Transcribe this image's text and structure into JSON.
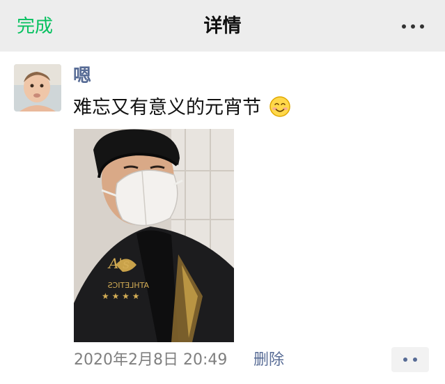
{
  "header": {
    "done_label": "完成",
    "title": "详情"
  },
  "post": {
    "username": "嗯",
    "text": "难忘又有意义的元宵节",
    "emoji": "smiling-face-blush",
    "timestamp": "2020年2月8日 20:49",
    "delete_label": "删除"
  },
  "icons": {
    "more": "more-dots-icon",
    "comment": "comment-dots-icon"
  },
  "colors": {
    "accent_green": "#07c160",
    "link_blue": "#576b95",
    "header_bg": "#ededed"
  }
}
